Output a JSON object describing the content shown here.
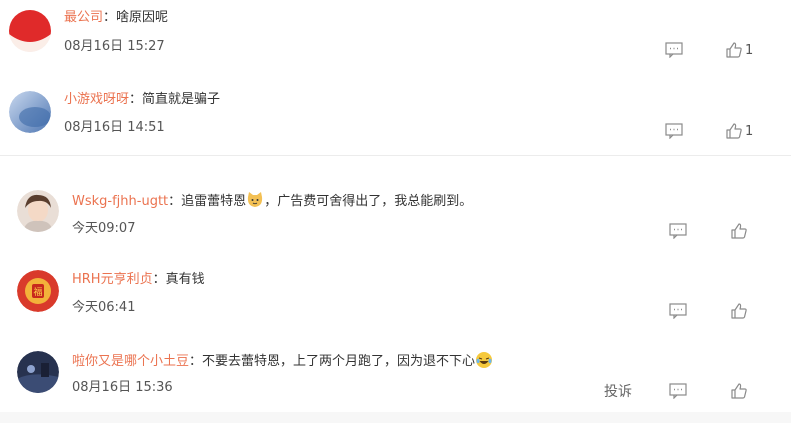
{
  "comments": [
    {
      "username": "最公司",
      "separator": "：",
      "text": "啥原因呢",
      "time": "08月16日 15:27",
      "like_count": "1"
    },
    {
      "username": "小游戏呀呀",
      "separator": "：",
      "text": "简直就是骗子",
      "time": "08月16日 14:51",
      "like_count": "1"
    },
    {
      "username": "Wskg-fjhh-ugtt",
      "separator": "：",
      "text_before": "追雷蕾特恩",
      "text_after": "，广告费可舍得出了，我总能刷到。",
      "time": "今天09:07",
      "like_count": ""
    },
    {
      "username": "HRH元亨利贞",
      "separator": "：",
      "text": "真有钱",
      "time": "今天06:41",
      "like_count": ""
    },
    {
      "username": "啦你又是哪个小土豆",
      "separator": "：",
      "text": "不要去蕾特恩，上了两个月跑了，因为退不下心",
      "time": "08月16日 15:36",
      "like_count": "",
      "report_label": "投诉"
    }
  ],
  "icons": {
    "comment": "comment-icon",
    "like": "thumbs-up-icon",
    "emoji_cat": "cat-face-emoji",
    "emoji_laugh": "laughing-emoji"
  },
  "colors": {
    "username": "#eb7350",
    "text": "#333333",
    "icon": "#8a8a8a"
  }
}
